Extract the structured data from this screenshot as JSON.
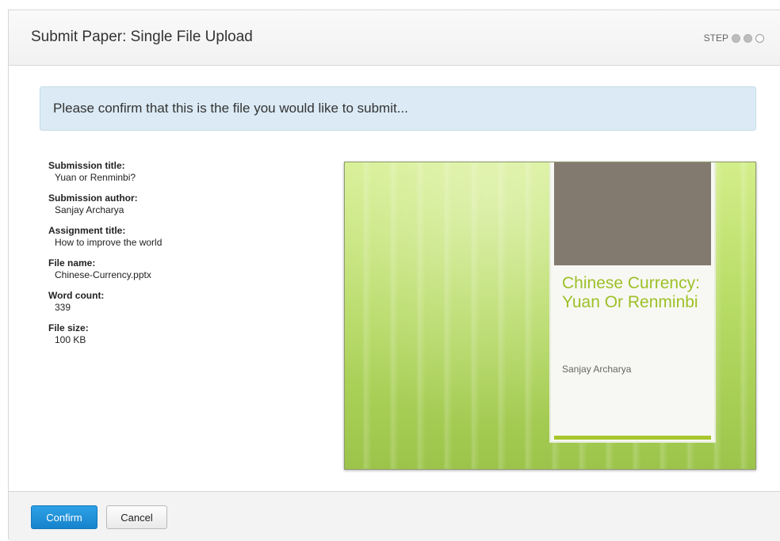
{
  "header": {
    "title": "Submit Paper: Single File Upload",
    "step_label": "STEP",
    "steps_total": 3,
    "steps_completed": 2
  },
  "banner": {
    "text": "Please confirm that this is the file you would like to submit..."
  },
  "details": [
    {
      "label": "Submission title:",
      "value": "Yuan or Renminbi?"
    },
    {
      "label": "Submission author:",
      "value": "Sanjay Archarya"
    },
    {
      "label": "Assignment title:",
      "value": "How to improve the world"
    },
    {
      "label": "File name:",
      "value": "Chinese-Currency.pptx"
    },
    {
      "label": "Word count:",
      "value": "339"
    },
    {
      "label": "File size:",
      "value": "100 KB"
    }
  ],
  "preview": {
    "slide_title": "Chinese Currency: Yuan Or Renminbi",
    "slide_author": "Sanjay Archarya"
  },
  "footer": {
    "confirm_label": "Confirm",
    "cancel_label": "Cancel"
  },
  "colors": {
    "primary_button": "#1683cc",
    "banner_bg": "#dbeaf4",
    "slide_accent": "#9dc027"
  }
}
